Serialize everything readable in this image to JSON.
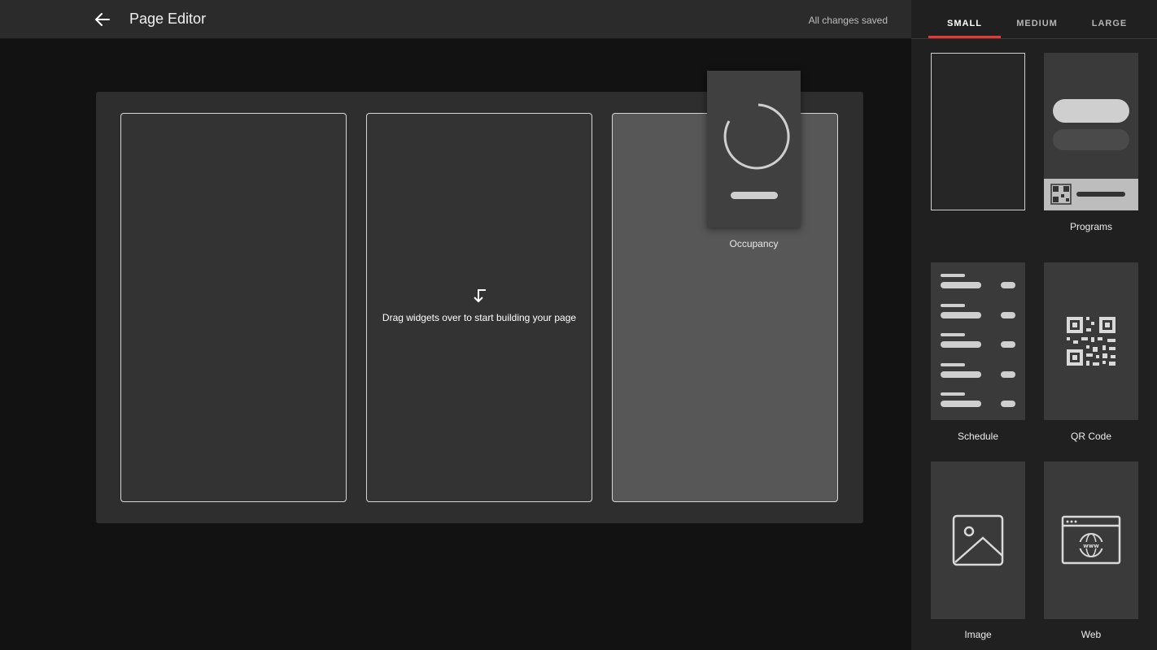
{
  "header": {
    "title": "Page Editor",
    "save_status": "All changes saved"
  },
  "canvas": {
    "drop_hint": "Drag widgets over to start building your page"
  },
  "dragging": {
    "label": "Occupancy"
  },
  "sidebar": {
    "tabs": [
      {
        "label": "SMALL",
        "active": true
      },
      {
        "label": "MEDIUM",
        "active": false
      },
      {
        "label": "LARGE",
        "active": false
      }
    ],
    "widgets": [
      {
        "label": ""
      },
      {
        "label": "Programs"
      },
      {
        "label": "Schedule"
      },
      {
        "label": "QR Code"
      },
      {
        "label": "Image"
      },
      {
        "label": "Web"
      }
    ]
  },
  "colors": {
    "accent": "#e53935",
    "background": "#121212",
    "panel": "#202020"
  }
}
